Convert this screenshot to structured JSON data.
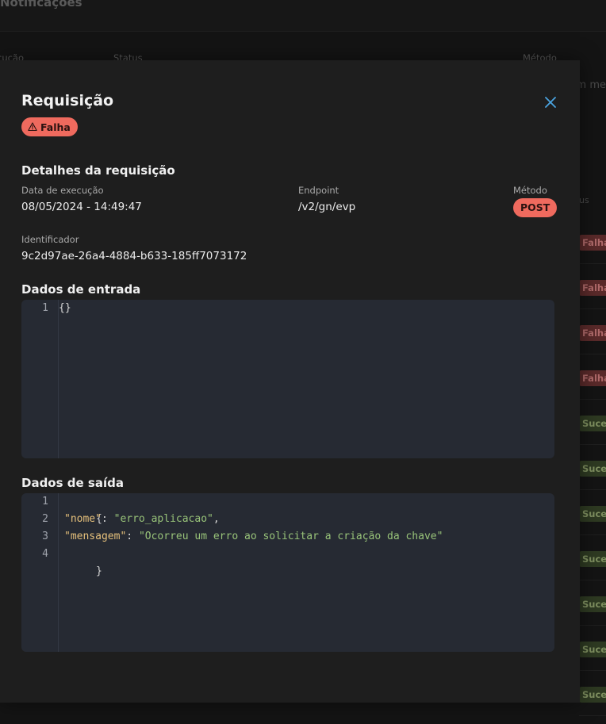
{
  "background": {
    "page_title": "Notificações",
    "columns": [
      "cução",
      "Status",
      "Método"
    ],
    "snippet": "im me",
    "status_header": "us",
    "rows": [
      {
        "status": "Falha",
        "kind": "fail"
      },
      {
        "status": "Falha",
        "kind": "fail"
      },
      {
        "status": "Falha",
        "kind": "fail"
      },
      {
        "status": "Falha",
        "kind": "fail"
      },
      {
        "status": "Suces",
        "kind": "ok"
      },
      {
        "status": "Suces",
        "kind": "ok"
      },
      {
        "status": "Suces",
        "kind": "ok"
      },
      {
        "status": "Suces",
        "kind": "ok"
      },
      {
        "status": "Suces",
        "kind": "ok"
      },
      {
        "status": "Suces",
        "kind": "ok"
      },
      {
        "status": "Suces",
        "kind": "ok"
      }
    ]
  },
  "modal": {
    "title": "Requisição",
    "close_icon": "close-icon",
    "status": {
      "label": "Falha",
      "icon": "warning-triangle-icon",
      "color": "#ef6a5e"
    },
    "details": {
      "heading": "Detalhes da requisição",
      "execution_date_label": "Data de execução",
      "execution_date": "08/05/2024 - 14:49:47",
      "endpoint_label": "Endpoint",
      "endpoint": "/v2/gn/evp",
      "method_label": "Método",
      "method": "POST",
      "identifier_label": "Identificador",
      "identifier": "9c2d97ae-26a4-4884-b633-185ff7073172"
    },
    "input": {
      "heading": "Dados de entrada",
      "line_numbers": [
        "1"
      ],
      "lines": [
        "{}"
      ]
    },
    "output": {
      "heading": "Dados de saída",
      "line_numbers": [
        "1",
        "2",
        "3",
        "4"
      ],
      "line1": "{",
      "line2_key": "\"nome\"",
      "line2_sep": ": ",
      "line2_val": "\"erro_aplicacao\"",
      "line2_end": ",",
      "line3_key": "\"mensagem\"",
      "line3_sep": ": ",
      "line3_val": "\"Ocorreu um erro ao solicitar a criação da chave\"",
      "line4": "}"
    }
  }
}
